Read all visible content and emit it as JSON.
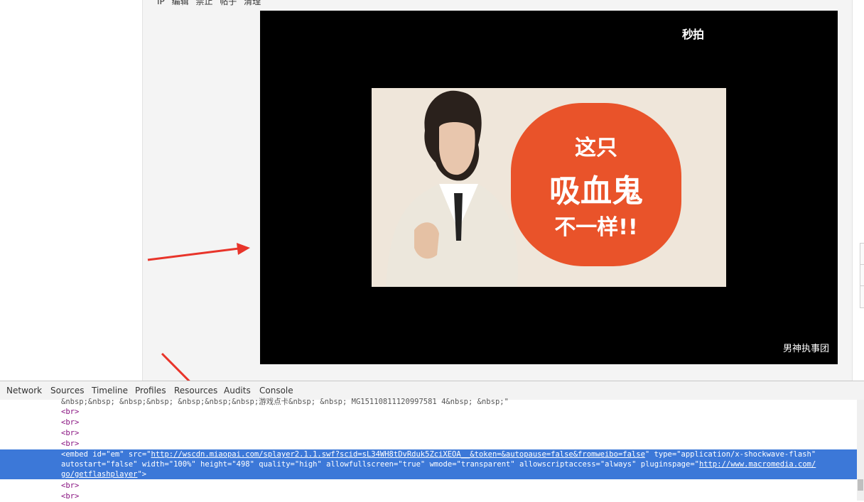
{
  "post_meta": {
    "items": [
      "IP",
      "编辑",
      "禁止",
      "帖子",
      "清理"
    ]
  },
  "video": {
    "logo": "秒拍",
    "caption": "男神执事团",
    "frame_text": {
      "line1": "这只",
      "line2": "吸血鬼",
      "line3": "不一样!!"
    }
  },
  "devtools": {
    "tabs": [
      "Network",
      "Sources",
      "Timeline",
      "Profiles",
      "Resources",
      "Audits",
      "Console"
    ]
  },
  "code": {
    "line_top": "&nbsp;&nbsp; &nbsp;&nbsp; &nbsp;&nbsp;&nbsp;游戏点卡&nbsp; &nbsp; MG15110811120997581 4&nbsp; &nbsp;\"",
    "br": "<br>",
    "embed": {
      "open": "<embed",
      "id_attr": "id",
      "id_val": "em",
      "src_attr": "src",
      "src_val": "http://wscdn.miaopai.com/splayer2.1.1.swf?scid=sL34WH8tDvRduk5ZciXEOA__&token=&autopause=false&fromweibo=false",
      "type_attr": "type",
      "type_val": "application/x-shockwave-flash",
      "autostart_attr": "autostart",
      "autostart_val": "false",
      "width_attr": "width",
      "width_val": "100%",
      "height_attr": "height",
      "height_val": "498",
      "quality_attr": "quality",
      "quality_val": "high",
      "fullscreen_attr": "allowfullscreen",
      "fullscreen_val": "true",
      "wmode_attr": "wmode",
      "wmode_val": "transparent",
      "script_attr": "allowscriptaccess",
      "script_val": "always",
      "pluginspage_attr": "pluginspage",
      "pluginspage_val_1": "http://www.macromedia.com/",
      "pluginspage_val_2": "go/getflashplayer",
      "close": ">"
    }
  },
  "colors": {
    "selection": "#3c78d8",
    "arrow": "#e8342a",
    "blob": "#e9532a"
  }
}
